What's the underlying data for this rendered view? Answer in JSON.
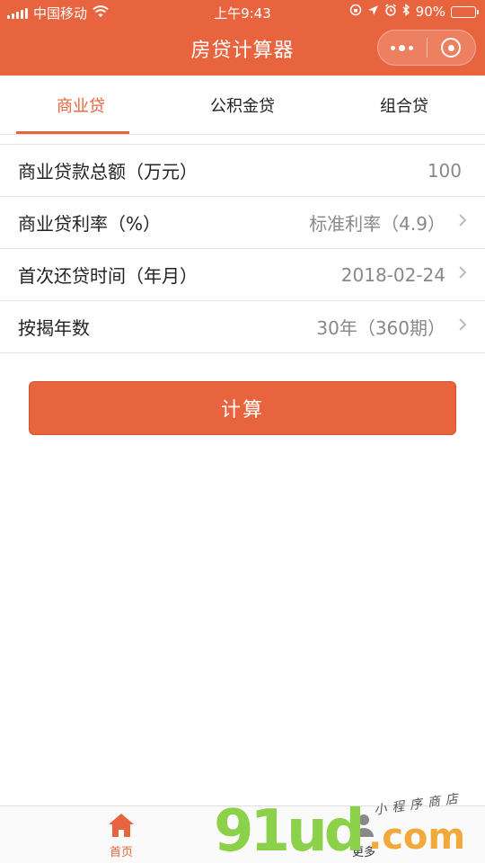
{
  "status_bar": {
    "carrier": "中国移动",
    "time": "上午9:43",
    "battery": "90%",
    "battery_fraction": 0.9
  },
  "nav": {
    "title": "房贷计算器"
  },
  "tabs": [
    {
      "label": "商业贷",
      "active": true
    },
    {
      "label": "公积金贷",
      "active": false
    },
    {
      "label": "组合贷",
      "active": false
    }
  ],
  "form": {
    "rows": [
      {
        "label": "商业贷款总额（万元）",
        "value": "100",
        "has_arrow": false
      },
      {
        "label": "商业贷利率（%）",
        "value": "标准利率（4.9）",
        "has_arrow": true
      },
      {
        "label": "首次还贷时间（年月）",
        "value": "2018-02-24",
        "has_arrow": true
      },
      {
        "label": "按揭年数",
        "value": "30年（360期）",
        "has_arrow": true
      }
    ]
  },
  "calc_button": {
    "label": "计算"
  },
  "tabbar": {
    "home_label": "首页",
    "more_label": "更多"
  },
  "watermark": {
    "digits": "91ud",
    "com": ".com",
    "chinese": "小程序商店"
  },
  "colors": {
    "accent": "#e8643f",
    "watermark_green": "#8bd14a",
    "watermark_orange": "#f2a93b"
  },
  "icons": {
    "wifi": "wifi-icon",
    "location": "location-arrow-icon",
    "alarm": "alarm-icon",
    "bluetooth": "bluetooth-icon",
    "lock_rotation": "rotation-lock-icon",
    "more_dots": "more-dots-icon",
    "close": "close-target-icon",
    "home": "home-icon",
    "chevron": "chevron-right-icon"
  }
}
